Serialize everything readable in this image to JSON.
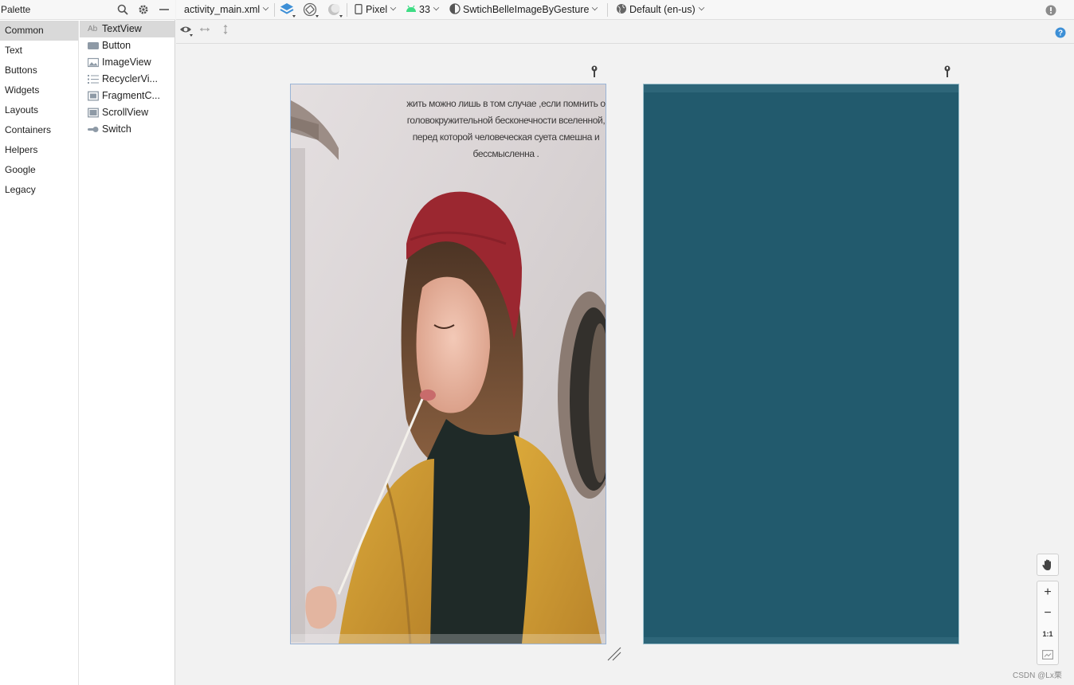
{
  "palette": {
    "title": "Palette",
    "categories": [
      "Common",
      "Text",
      "Buttons",
      "Widgets",
      "Layouts",
      "Containers",
      "Helpers",
      "Google",
      "Legacy"
    ],
    "active_category": "Common",
    "widgets": [
      {
        "label": "TextView",
        "icon": "textview-icon",
        "icon_text": "Ab"
      },
      {
        "label": "Button",
        "icon": "button-icon"
      },
      {
        "label": "ImageView",
        "icon": "imageview-icon"
      },
      {
        "label": "RecyclerVi...",
        "icon": "recyclerview-icon"
      },
      {
        "label": "FragmentC...",
        "icon": "fragmentcontainer-icon"
      },
      {
        "label": "ScrollView",
        "icon": "scrollview-icon"
      },
      {
        "label": "Switch",
        "icon": "switch-icon"
      }
    ]
  },
  "toolbar": {
    "file": "activity_main.xml",
    "device": "Pixel",
    "api": "33",
    "theme": "SwtichBelleImageByGesture",
    "locale": "Default (en-us)"
  },
  "design": {
    "quote": "жить можно лишь в том случае ,если помнить о головокружительной бесконечности вселенной, перед которой человеческая суета смешна и бессмысленна ."
  },
  "zoom": {
    "plus": "+",
    "minus": "−",
    "one_to_one": "1:1"
  },
  "watermark": "CSDN @Lx栗",
  "colors": {
    "accent": "#3d8fd6",
    "blueprint": "#225a6d",
    "android_green": "#3ddc84"
  }
}
